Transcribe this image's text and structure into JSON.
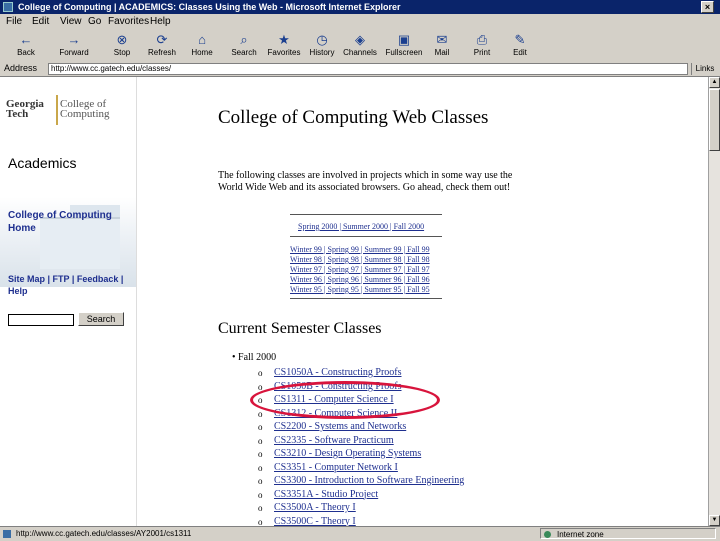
{
  "window": {
    "title": "College of Computing | ACADEMICS: Classes Using the Web - Microsoft Internet Explorer",
    "close_label": "×"
  },
  "menu": [
    "File",
    "Edit",
    "View",
    "Go",
    "Favorites",
    "Help"
  ],
  "toolbar": [
    {
      "label": "Back",
      "icon": "back-arrow-icon",
      "glyph": "←"
    },
    {
      "label": "Forward",
      "icon": "forward-arrow-icon",
      "glyph": "→"
    },
    {
      "label": "Stop",
      "icon": "stop-icon",
      "glyph": "⊗"
    },
    {
      "label": "Refresh",
      "icon": "refresh-icon",
      "glyph": "⟳"
    },
    {
      "label": "Home",
      "icon": "home-icon",
      "glyph": "⌂"
    },
    {
      "label": "Search",
      "icon": "search-icon",
      "glyph": "⌕"
    },
    {
      "label": "Favorites",
      "icon": "favorites-icon",
      "glyph": "★"
    },
    {
      "label": "History",
      "icon": "history-icon",
      "glyph": "◷"
    },
    {
      "label": "Channels",
      "icon": "channels-icon",
      "glyph": "◈"
    },
    {
      "label": "Fullscreen",
      "icon": "fullscreen-icon",
      "glyph": "▣"
    },
    {
      "label": "Mail",
      "icon": "mail-icon",
      "glyph": "✉"
    },
    {
      "label": "Print",
      "icon": "print-icon",
      "glyph": "⎙"
    },
    {
      "label": "Edit",
      "icon": "edit-icon",
      "glyph": "✎"
    }
  ],
  "address": {
    "label": "Address",
    "url": "http://www.cc.gatech.edu/classes/",
    "links_label": "Links"
  },
  "sidebar": {
    "logo_left": "Georgia Tech",
    "logo_right": "College of Computing",
    "title": "Academics",
    "home_link_1": "College of Computing",
    "home_link_2": "Home",
    "util_line_1": "Site Map | FTP | Feedback |",
    "util_line_2": "Help",
    "search_button": "Search"
  },
  "main": {
    "title": "College of Computing Web Classes",
    "intro": "The following classes are involved in projects which in some way use the World Wide Web and its associated browsers. Go ahead, check them out!",
    "semesters_top": "Spring 2000 | Summer 2000 | Fall 2000",
    "semester_rows": [
      "Winter 99 | Spring 99 | Summer 99 | Fall 99",
      "Winter 98 | Spring 98 | Summer 98 | Fall 98",
      "Winter 97 | Spring 97 | Summer 97 | Fall 97",
      "Winter 96 | Spring 96 | Summer 96 | Fall 96",
      "Winter 95 | Spring 95 | Summer 95 | Fall 95"
    ],
    "section_title": "Current Semester Classes",
    "term": "Fall 2000",
    "courses": [
      "CS1050A - Constructing Proofs",
      "CS1050B - Constructing Proofs",
      "CS1311 - Computer Science I",
      "CS1312 - Computer Science II",
      "CS2200 - Systems and Networks",
      "CS2335 - Software Practicum",
      "CS3210 - Design Operating Systems",
      "CS3351 - Computer Network I",
      "CS3300 - Introduction to Software Engineering",
      "CS3351A - Studio Project",
      "CS3500A - Theory I",
      "CS3500C - Theory I"
    ]
  },
  "status": {
    "text": "http://www.cc.gatech.edu/classes/AY2001/cs1311",
    "zone": "Internet zone"
  },
  "colors": {
    "titlebar": "#0a246a",
    "link": "#1e2f8f",
    "highlight": "#d8143c"
  }
}
